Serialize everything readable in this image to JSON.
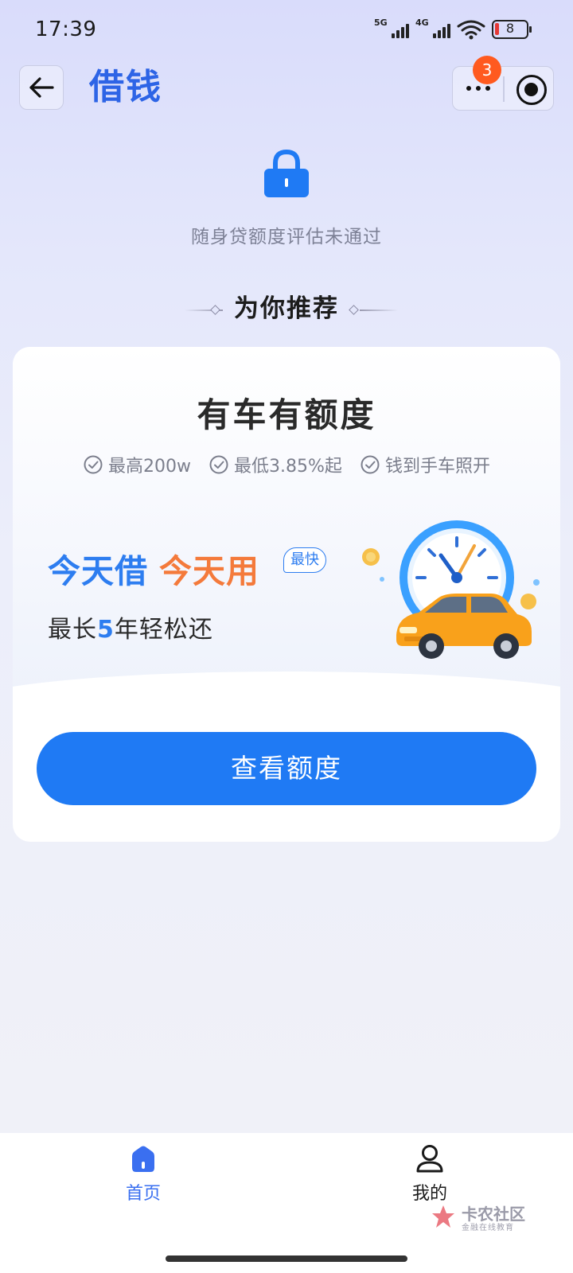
{
  "status_bar": {
    "time": "17:39",
    "network_1": "5G",
    "network_2": "4G",
    "battery_level": "8"
  },
  "header": {
    "title": "借钱",
    "notification_count": "3"
  },
  "assessment": {
    "icon": "lock-icon",
    "text": "随身贷额度评估未通过"
  },
  "recommend": {
    "heading": "为你推荐"
  },
  "card": {
    "title": "有车有额度",
    "features": [
      "最高200w",
      "最低3.85%起",
      "钱到手车照开"
    ],
    "slogan_part1": "今天借",
    "slogan_part2": "今天用",
    "fast_tag": "最快",
    "repay_prefix": "最长",
    "repay_number": "5",
    "repay_suffix": "年轻松还",
    "cta_label": "查看额度"
  },
  "bottom_nav": {
    "items": [
      {
        "label": "首页",
        "icon": "home-icon",
        "active": true
      },
      {
        "label": "我的",
        "icon": "user-icon",
        "active": false
      }
    ]
  },
  "watermark": {
    "text": "卡农社区",
    "sub": "金融在线教育"
  },
  "colors": {
    "accent": "#1f7af4",
    "title_blue": "#2d64e6",
    "orange": "#f47a3b",
    "badge": "#ff5a1f"
  }
}
